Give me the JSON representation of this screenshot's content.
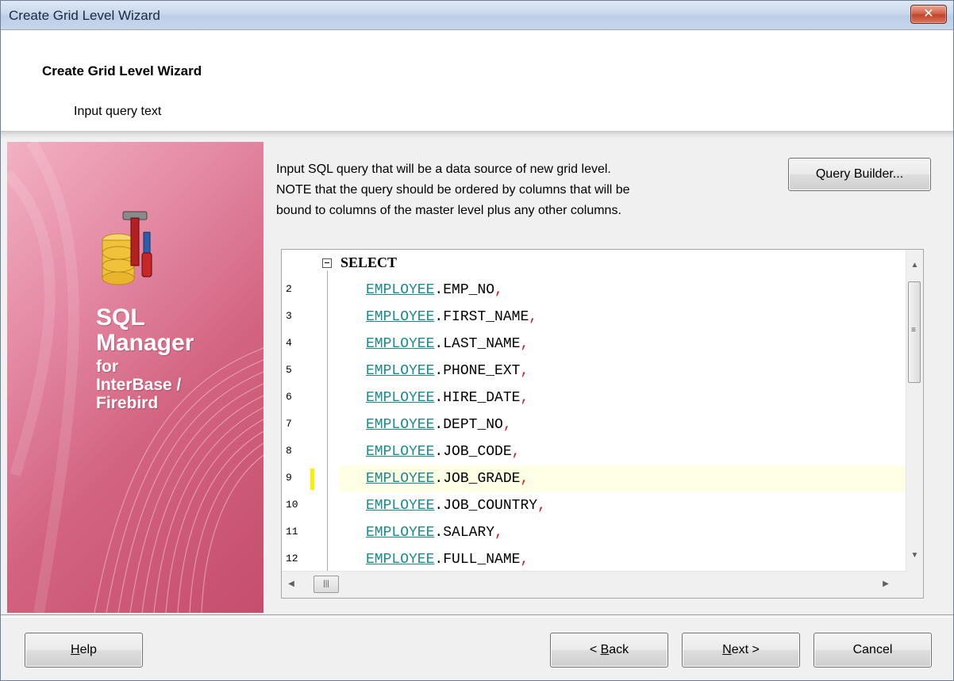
{
  "window": {
    "title": "Create Grid Level Wizard",
    "close_glyph": "✕"
  },
  "header": {
    "title": "Create Grid Level Wizard",
    "subtitle": "Input query text"
  },
  "banner": {
    "line1": "SQL",
    "line2": "Manager",
    "line3": "for",
    "line4": "InterBase /",
    "line5": "Firebird",
    "colors": {
      "pink_light": "#f2b1c3",
      "pink_dark": "#c54e6c"
    }
  },
  "description": {
    "line1": "Input SQL query that will be a data source of new grid level.",
    "line2": "NOTE that the query should be ordered by columns that will be",
    "line3": "bound to columns of the master level plus any other columns."
  },
  "query_builder_button": {
    "label": "Query Builder..."
  },
  "editor": {
    "keyword": "SELECT",
    "lines": [
      {
        "num": "2",
        "table": "EMPLOYEE",
        "column": "EMP_NO",
        "punct": ","
      },
      {
        "num": "3",
        "table": "EMPLOYEE",
        "column": "FIRST_NAME",
        "punct": ","
      },
      {
        "num": "4",
        "table": "EMPLOYEE",
        "column": "LAST_NAME",
        "punct": ","
      },
      {
        "num": "5",
        "table": "EMPLOYEE",
        "column": "PHONE_EXT",
        "punct": ","
      },
      {
        "num": "6",
        "table": "EMPLOYEE",
        "column": "HIRE_DATE",
        "punct": ","
      },
      {
        "num": "7",
        "table": "EMPLOYEE",
        "column": "DEPT_NO",
        "punct": ","
      },
      {
        "num": "8",
        "table": "EMPLOYEE",
        "column": "JOB_CODE",
        "punct": ","
      },
      {
        "num": "9",
        "table": "EMPLOYEE",
        "column": "JOB_GRADE",
        "punct": ","
      },
      {
        "num": "10",
        "table": "EMPLOYEE",
        "column": "JOB_COUNTRY",
        "punct": ","
      },
      {
        "num": "11",
        "table": "EMPLOYEE",
        "column": "SALARY",
        "punct": ","
      },
      {
        "num": "12",
        "table": "EMPLOYEE",
        "column": "FULL_NAME",
        "punct": ","
      }
    ],
    "current_line": "9",
    "colors": {
      "table": "#1a8a8a",
      "comma": "#c02020",
      "highlight": "#ffffe5",
      "marker": "#ffee00"
    }
  },
  "footer": {
    "help": {
      "mnemonic": "H",
      "rest": "elp"
    },
    "back": {
      "prefix": "< ",
      "mnemonic": "B",
      "rest": "ack"
    },
    "next": {
      "mnemonic": "N",
      "rest": "ext >"
    },
    "cancel": {
      "label": "Cancel"
    }
  }
}
